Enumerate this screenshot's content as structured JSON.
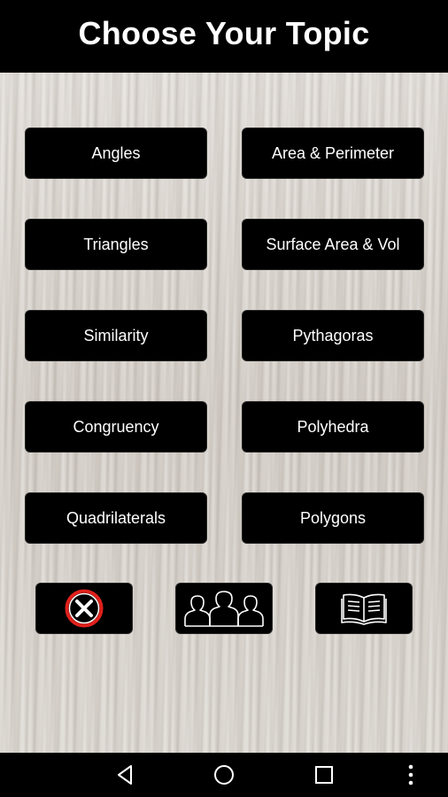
{
  "header": {
    "title": "Choose Your Topic"
  },
  "topics": [
    {
      "label": "Angles"
    },
    {
      "label": "Area & Perimeter"
    },
    {
      "label": "Triangles"
    },
    {
      "label": "Surface Area & Vol"
    },
    {
      "label": "Similarity"
    },
    {
      "label": "Pythagoras"
    },
    {
      "label": "Congruency"
    },
    {
      "label": "Polyhedra"
    },
    {
      "label": "Quadrilaterals"
    },
    {
      "label": "Polygons"
    }
  ],
  "toolbar": {
    "icons": [
      "close-icon",
      "people-icon",
      "book-icon"
    ]
  },
  "navbar": {
    "icons": [
      "back-icon",
      "home-icon",
      "recent-apps-icon",
      "overflow-menu-icon"
    ]
  },
  "colors": {
    "button_bg": "#000000",
    "button_text": "#ffffff",
    "close_accent": "#e0201b",
    "background": "#dcd6d0"
  }
}
